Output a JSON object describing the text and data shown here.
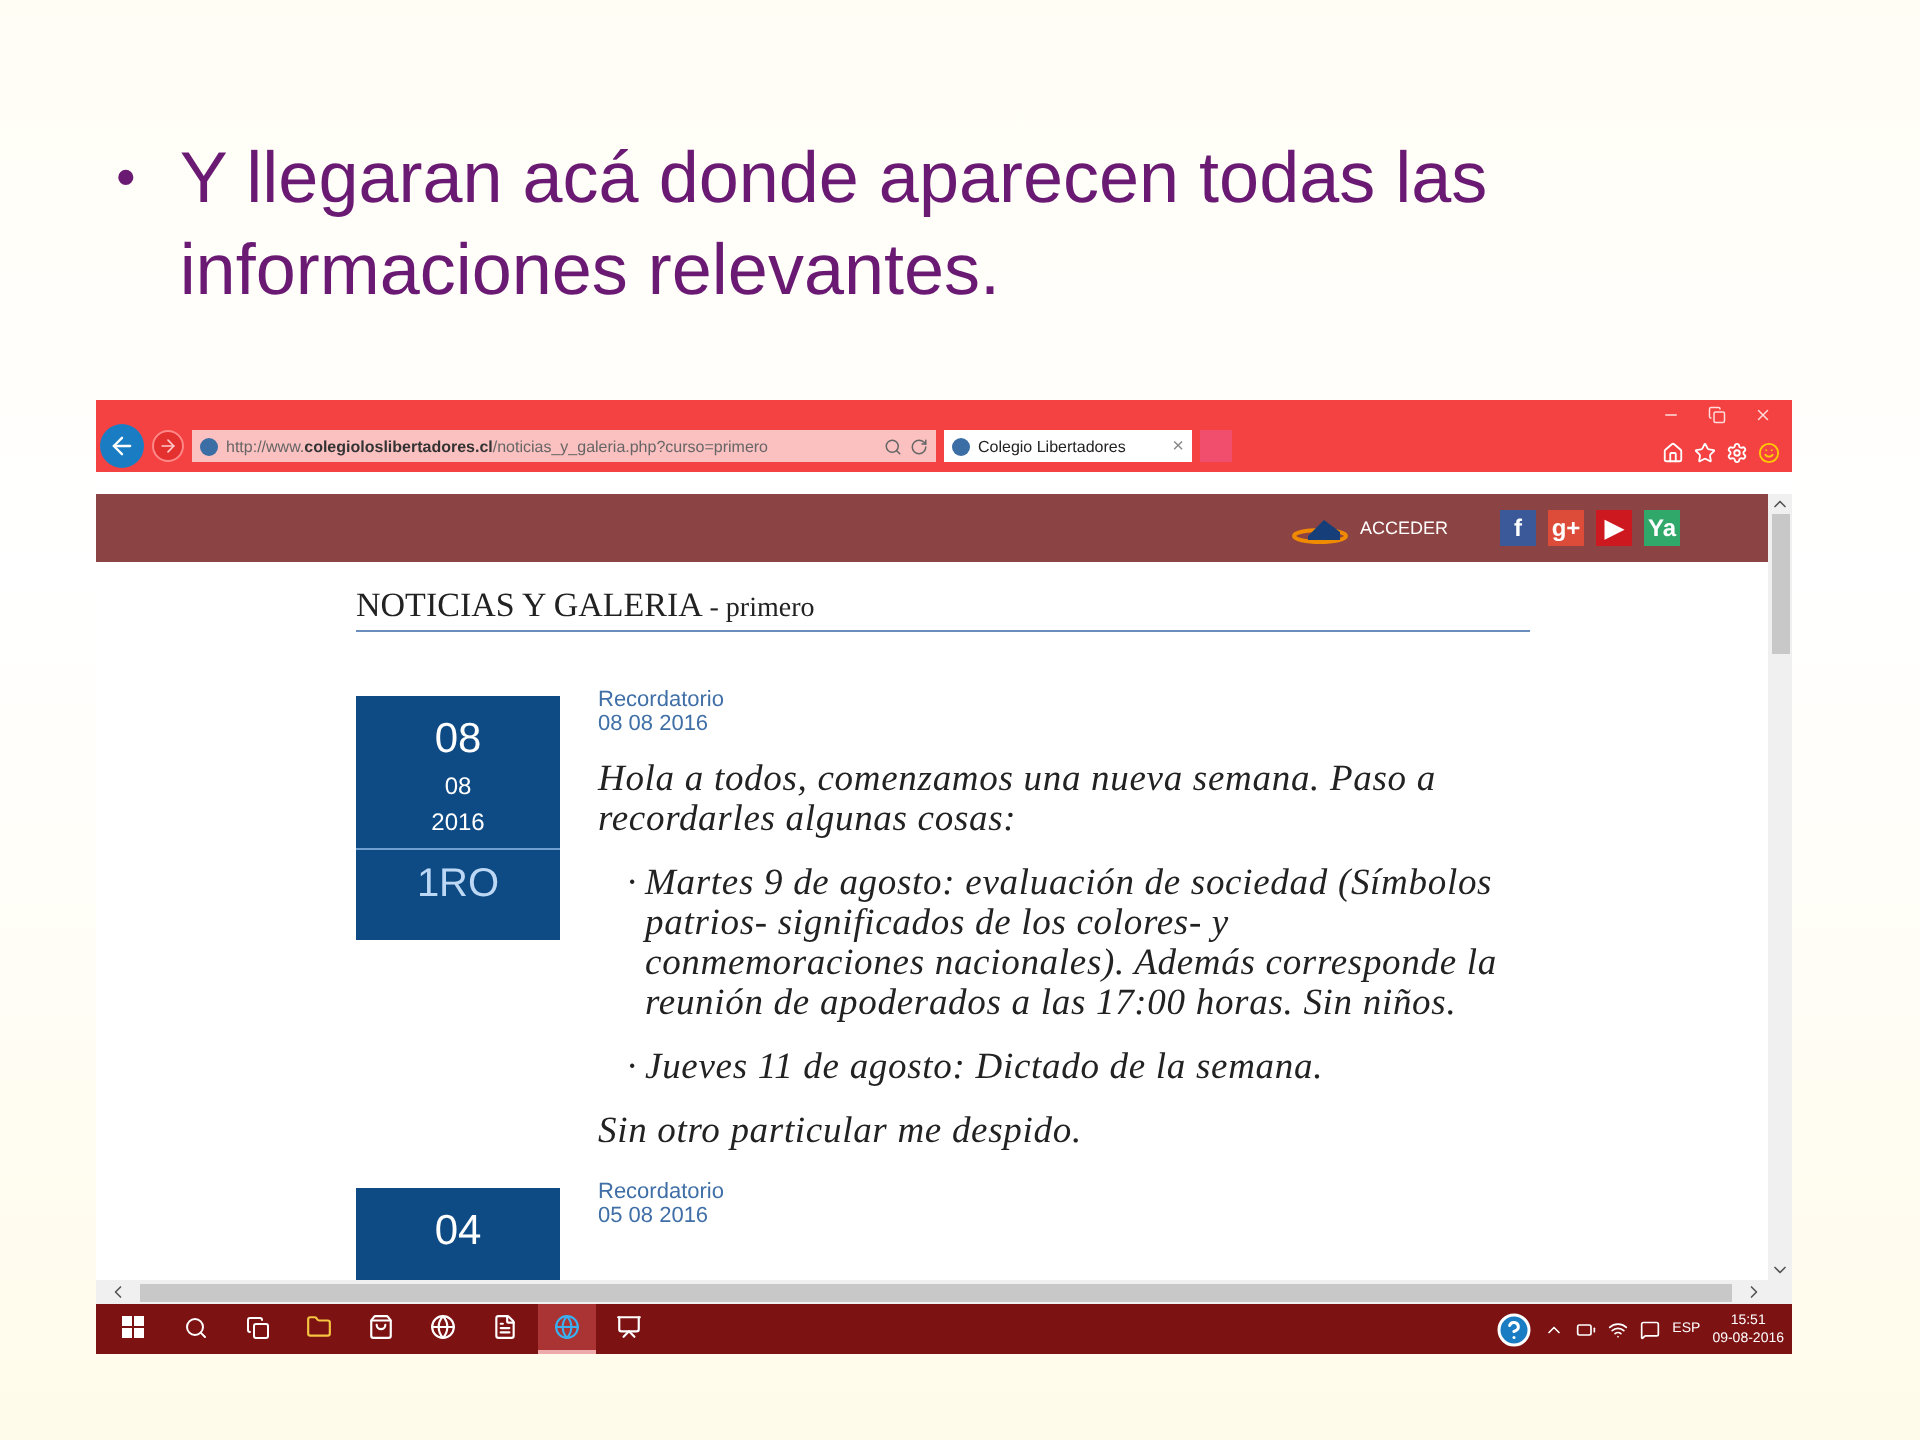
{
  "slide": {
    "bullet": "•",
    "title": "Y llegaran acá donde aparecen todas las informaciones relevantes."
  },
  "browser": {
    "url": "http://www.**colegioloslibertadores.cl**/noticias_y_galeria.php?curso=primero",
    "tab": {
      "title": "Colegio Libertadores",
      "close": "×",
      "selected": true
    }
  },
  "site": {
    "login": "ACCEDER",
    "social": [
      {
        "label": "f",
        "color": "#3b5998"
      },
      {
        "label": "g+",
        "color": "#dd4b39"
      },
      {
        "label": "▶",
        "color": "#cc181e"
      },
      {
        "label": "Ya",
        "color": "#2fa86a"
      }
    ]
  },
  "page": {
    "heading": "NOTICIAS Y GALERIA",
    "subheading": "- primero",
    "posts": [
      {
        "day": "08",
        "month": "08",
        "year": "2016",
        "course": "1RO",
        "category": "Recordatorio",
        "date": "08 08 2016",
        "intro": "Hola a todos, comenzamos una nueva semana. Paso a recordarles algunas cosas:",
        "bullet": "·",
        "items": [
          "Martes 9 de agosto: evaluación de sociedad (Símbolos patrios- significados de los colores-  y conmemoraciones nacionales). Además corresponde la reunión de apoderados a las 17:00 horas. Sin niños.",
          "Jueves 11 de agosto: Dictado de la semana."
        ],
        "closing": "Sin otro particular me despido."
      },
      {
        "day": "04",
        "category": "Recordatorio",
        "date": "05 08 2016"
      }
    ]
  },
  "taskbar": {
    "apps": [
      {
        "kind": "explorer",
        "selected": false
      },
      {
        "kind": "store",
        "selected": false
      },
      {
        "kind": "hp",
        "selected": false
      },
      {
        "kind": "word",
        "selected": false
      },
      {
        "kind": "ie",
        "selected": true
      },
      {
        "kind": "powerpoint",
        "selected": false
      }
    ],
    "lang": "ESP",
    "time": "15:51",
    "date": "09-08-2016"
  }
}
